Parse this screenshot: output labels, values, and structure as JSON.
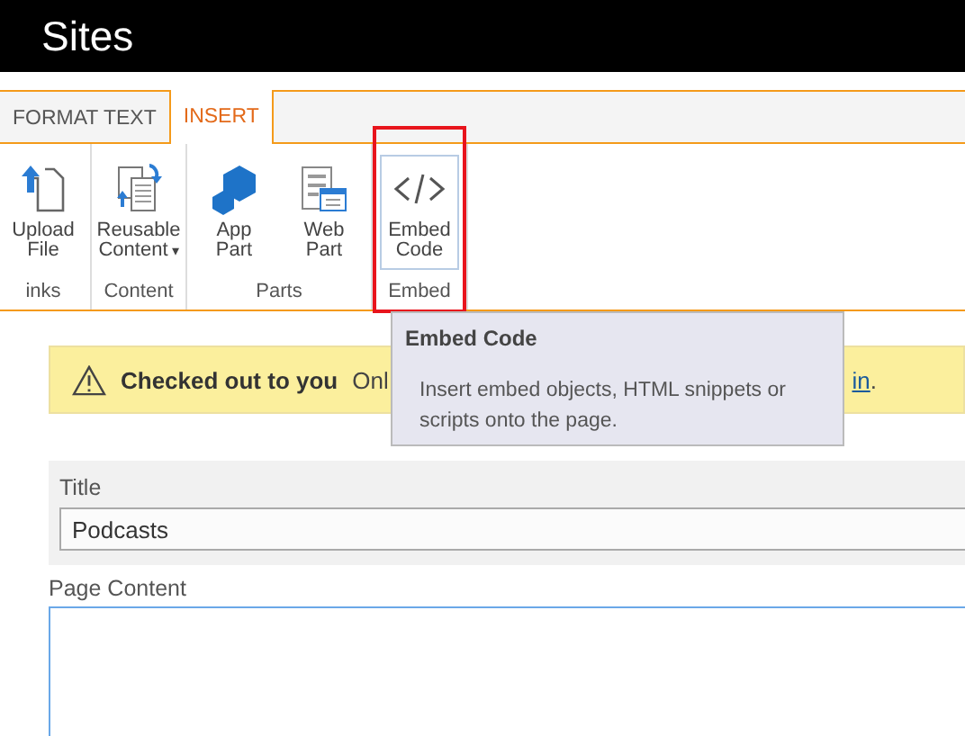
{
  "header": {
    "title": "Sites"
  },
  "tabs": [
    {
      "label": "FORMAT TEXT",
      "selected": false
    },
    {
      "label": "INSERT",
      "selected": true
    }
  ],
  "ribbon": {
    "groups": [
      {
        "label": "inks",
        "highlighted": false,
        "buttons": [
          {
            "label": "Upload File",
            "kind": "upload",
            "selected": false
          }
        ]
      },
      {
        "label": "Content",
        "highlighted": false,
        "buttons": [
          {
            "label": "Reusable Content",
            "kind": "reusable",
            "selected": false,
            "caret": "▾"
          }
        ]
      },
      {
        "label": "Parts",
        "highlighted": false,
        "buttons": [
          {
            "label": "App Part",
            "kind": "app",
            "selected": false
          },
          {
            "label": "Web Part",
            "kind": "web",
            "selected": false
          }
        ]
      },
      {
        "label": "Embed",
        "highlighted": true,
        "buttons": [
          {
            "label": "Embed Code",
            "kind": "embed",
            "selected": true
          }
        ]
      }
    ]
  },
  "tooltip": {
    "title": "Embed Code",
    "text": "Insert embed objects, HTML snippets or scripts onto the page."
  },
  "banner": {
    "title": "Checked out to you",
    "text": "Onl",
    "link": "in",
    "trailing": "."
  },
  "form": {
    "title_label": "Title",
    "title_value": "Podcasts",
    "content_label": "Page Content"
  }
}
